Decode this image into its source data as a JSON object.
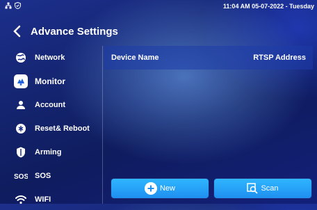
{
  "status": {
    "datetime": "11:04 AM  05-07-2022 - Tuesday"
  },
  "header": {
    "title": "Advance Settings"
  },
  "sidebar": {
    "items": [
      {
        "label": "Network",
        "icon": "network-icon"
      },
      {
        "label": "Monitor",
        "icon": "monitor-icon",
        "active": true
      },
      {
        "label": "Account",
        "icon": "account-icon"
      },
      {
        "label": "Reset& Reboot",
        "icon": "reset-icon"
      },
      {
        "label": "Arming",
        "icon": "shield-icon"
      },
      {
        "label": "SOS",
        "icon": "sos-icon"
      },
      {
        "label": "WIFI",
        "icon": "wifi-icon"
      }
    ]
  },
  "table": {
    "columns": [
      "Device Name",
      "RTSP Address"
    ]
  },
  "actions": {
    "new_label": "New",
    "scan_label": "Scan"
  },
  "colors": {
    "button": "#27a4ff",
    "background": "#14246f"
  }
}
